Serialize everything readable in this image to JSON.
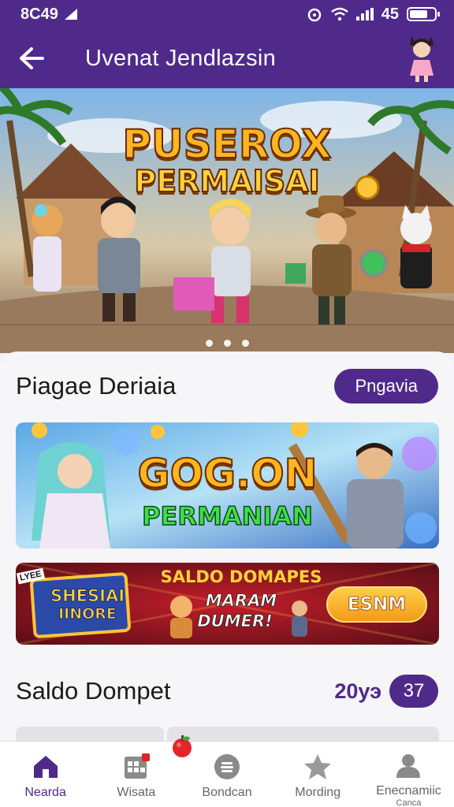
{
  "status_bar": {
    "time": "8C49",
    "battery_text": "45"
  },
  "app_bar": {
    "title": "Uvenat Jendlazsin"
  },
  "hero": {
    "title_line1": "PUSEROX",
    "title_line2": "PERMAISAI"
  },
  "section1": {
    "title": "Piagae Deriaia",
    "button_label": "Pngavia",
    "banner1": {
      "line1": "GOG.ON",
      "line2": "PERMANIAN"
    },
    "banner2": {
      "tag": "LYEE",
      "badge_line1": "SHESIAI",
      "badge_line2": "IINORE",
      "headline": "SALDO DOMAPES",
      "sub_line1": "MARAM",
      "sub_line2": "DUMER!",
      "cta_label": "ESNM"
    }
  },
  "section2": {
    "title": "Saldo Dompet",
    "side_text": "20уэ",
    "count": "37"
  },
  "bottom_nav": {
    "items": [
      {
        "label": "Nearda",
        "icon": "home-icon"
      },
      {
        "label": "Wisata",
        "icon": "grid-calendar-icon"
      },
      {
        "label": "Bondcan",
        "icon": "coin-icon"
      },
      {
        "label": "Mording",
        "icon": "star-icon"
      },
      {
        "label": "Enecnamiic",
        "sublabel": "Canca",
        "icon": "profile-icon"
      }
    ]
  },
  "colors": {
    "primary": "#4f2a8a",
    "accent_gold": "#ffb51f",
    "cta_orange": "#f39a17"
  }
}
